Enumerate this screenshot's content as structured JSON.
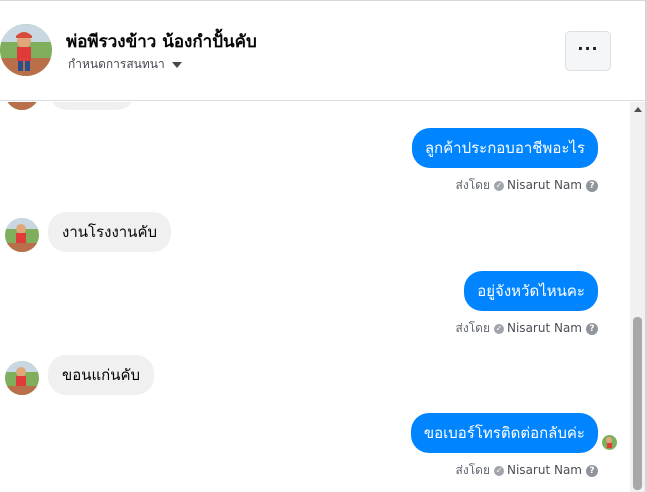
{
  "header": {
    "title": "พ่อพีรวงข้าว น้องกำปั้นคับ",
    "subtitle": "กำหนดการสนทนา",
    "more_label": "···"
  },
  "messages": [
    {
      "direction": "in",
      "text": ""
    },
    {
      "direction": "out",
      "text": "ลูกค้าประกอบอาชีพอะไร",
      "sent_by_label": "ส่งโดย",
      "sender": "Nisarut Nam",
      "help": "?"
    },
    {
      "direction": "in",
      "text": "งานโรงงานคับ"
    },
    {
      "direction": "out",
      "text": "อยู่จังหวัดไหนคะ",
      "sent_by_label": "ส่งโดย",
      "sender": "Nisarut Nam",
      "help": "?"
    },
    {
      "direction": "in",
      "text": "ขอนแก่นคับ"
    },
    {
      "direction": "out",
      "text": "ขอเบอร์โทรติดต่อกลับค่ะ",
      "sent_by_label": "ส่งโดย",
      "sender": "Nisarut Nam",
      "help": "?"
    }
  ],
  "icons": {
    "check": "✓",
    "verified": "circle-check-icon",
    "help": "help-circle-icon",
    "caret": "caret-down-icon"
  },
  "colors": {
    "outgoing_bubble": "#0084ff",
    "incoming_bubble": "#f1f0f0"
  }
}
